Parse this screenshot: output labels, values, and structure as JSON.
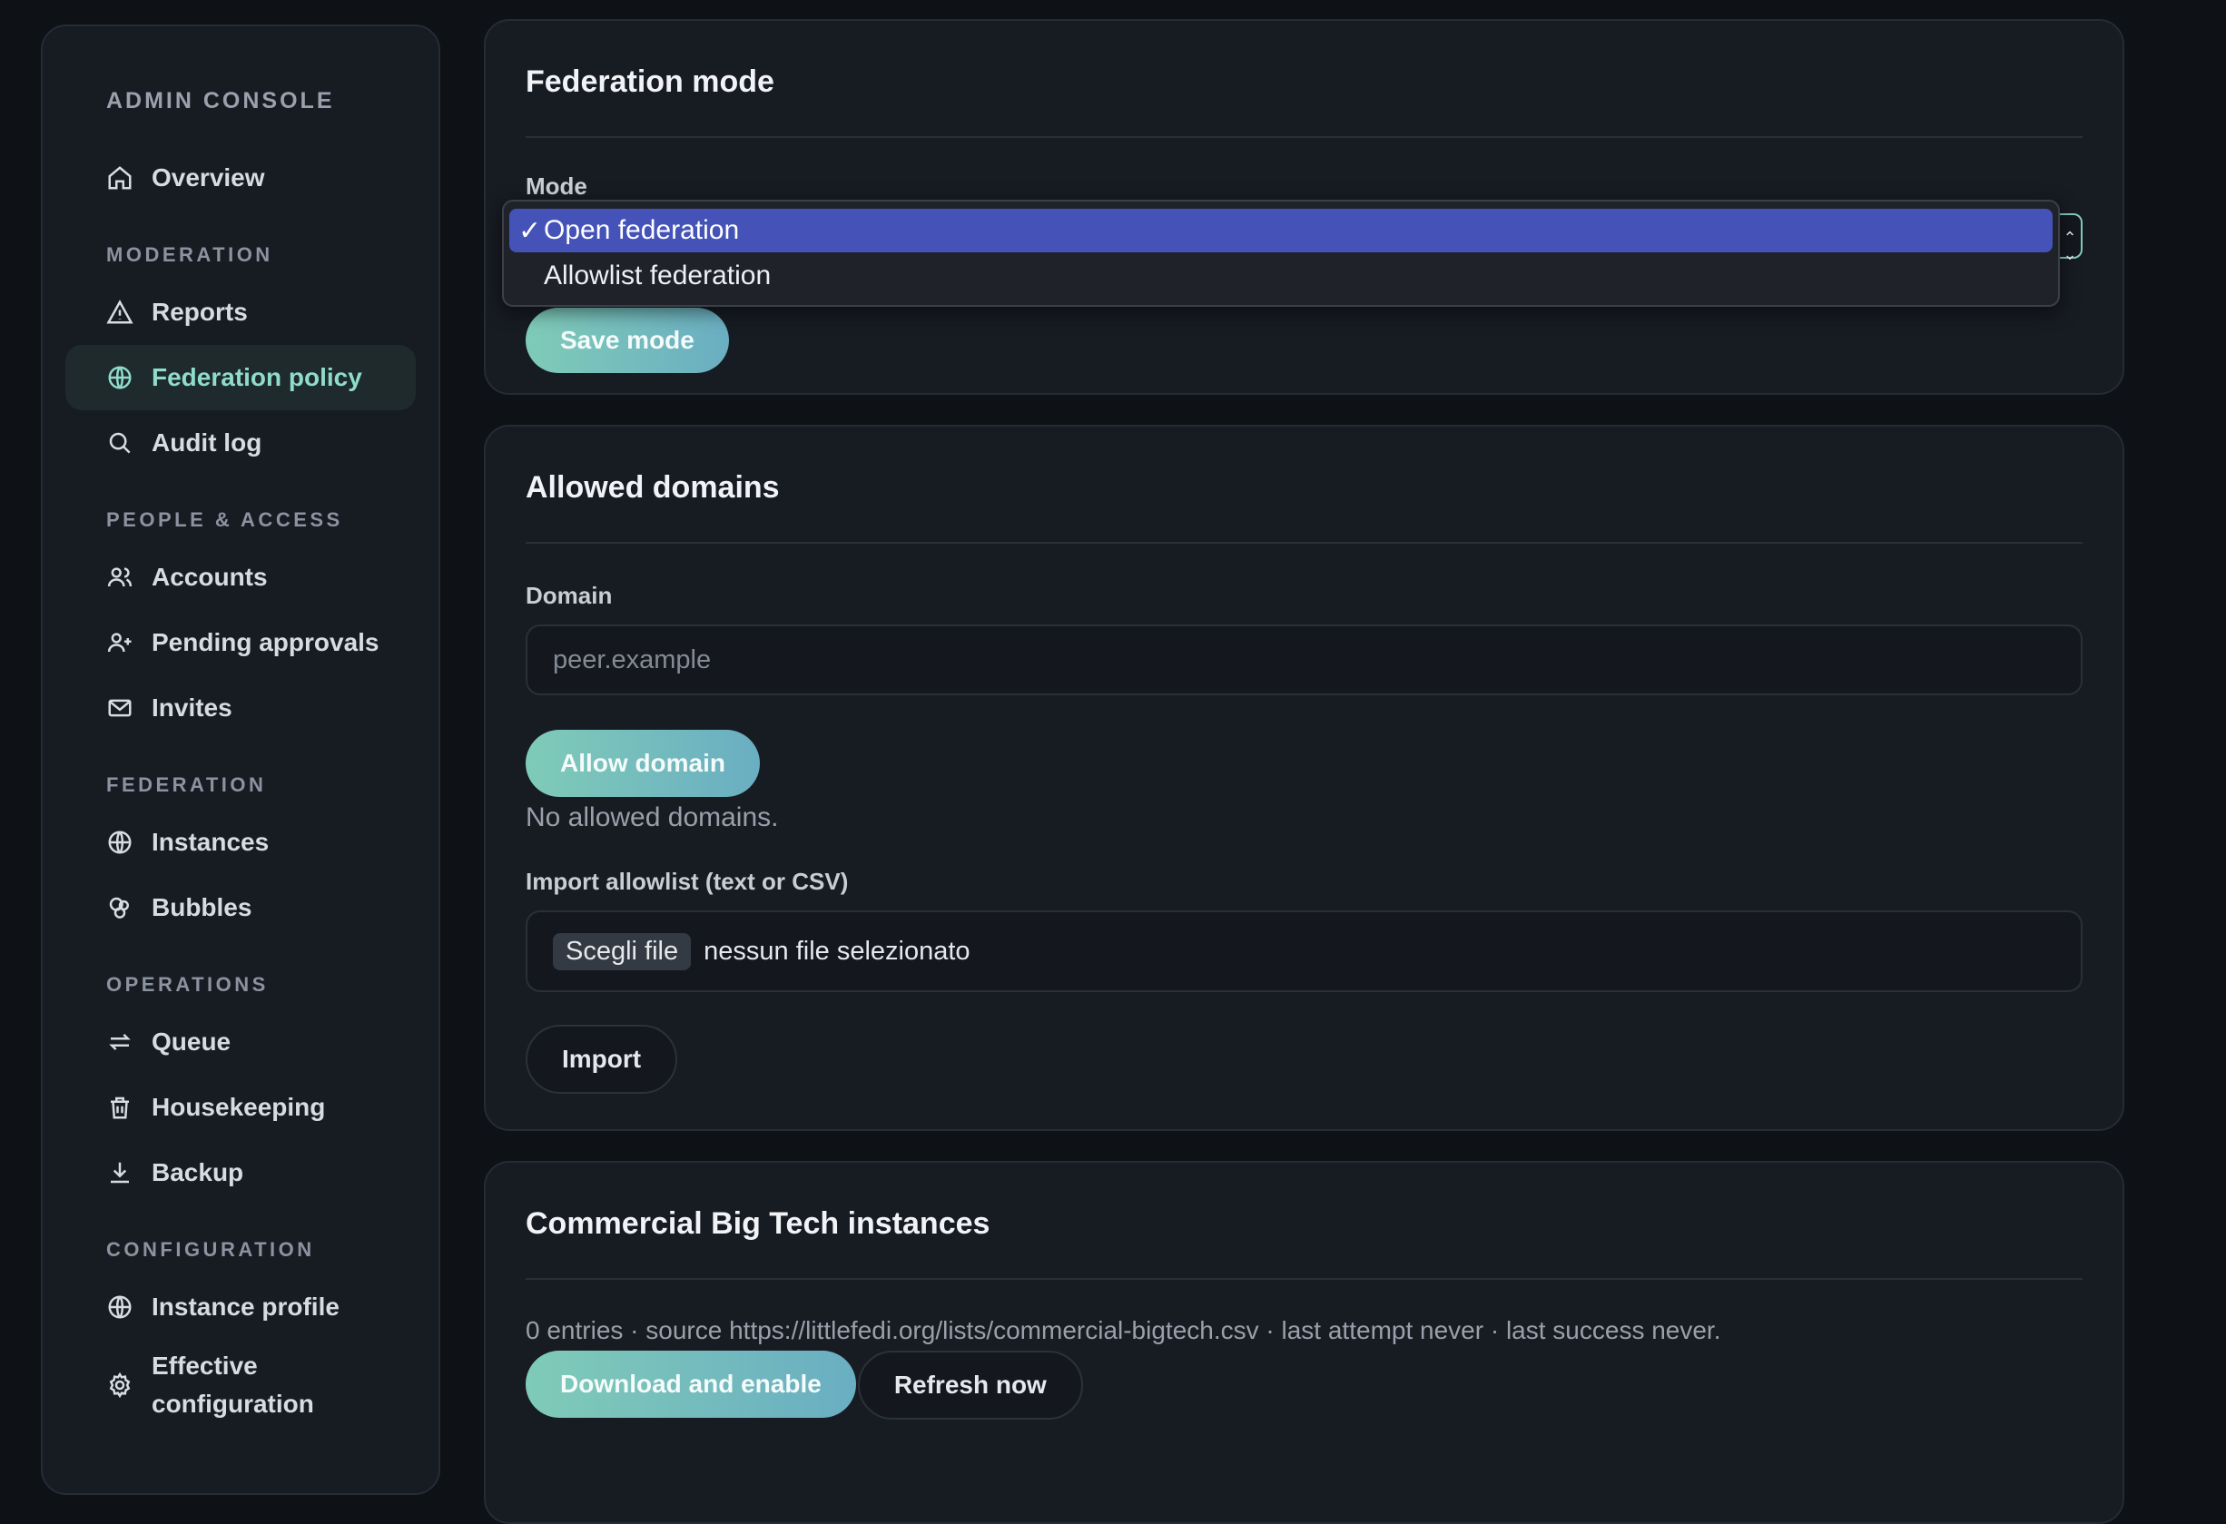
{
  "sidebar": {
    "brand": "ADMIN CONSOLE",
    "sections": {
      "top": [
        {
          "label": "Overview",
          "icon": "home-icon"
        }
      ],
      "moderation": {
        "title": "MODERATION",
        "items": [
          {
            "label": "Reports",
            "icon": "warning-icon"
          },
          {
            "label": "Federation policy",
            "icon": "globe-icon",
            "active": true
          },
          {
            "label": "Audit log",
            "icon": "search-icon"
          }
        ]
      },
      "people": {
        "title": "PEOPLE & ACCESS",
        "items": [
          {
            "label": "Accounts",
            "icon": "users-icon"
          },
          {
            "label": "Pending approvals",
            "icon": "user-plus-icon"
          },
          {
            "label": "Invites",
            "icon": "mail-icon"
          }
        ]
      },
      "federation": {
        "title": "FEDERATION",
        "items": [
          {
            "label": "Instances",
            "icon": "globe-icon"
          },
          {
            "label": "Bubbles",
            "icon": "bubbles-icon"
          }
        ]
      },
      "operations": {
        "title": "OPERATIONS",
        "items": [
          {
            "label": "Queue",
            "icon": "repeat-icon"
          },
          {
            "label": "Housekeeping",
            "icon": "trash-icon"
          },
          {
            "label": "Backup",
            "icon": "download-icon"
          }
        ]
      },
      "configuration": {
        "title": "CONFIGURATION",
        "items": [
          {
            "label": "Instance profile",
            "icon": "globe-icon"
          },
          {
            "label": "Effective configuration",
            "icon": "gear-icon"
          }
        ]
      }
    }
  },
  "mode_card": {
    "title": "Federation mode",
    "mode_label": "Mode",
    "selected": "Open federation",
    "options": [
      "Open federation",
      "Allowlist federation"
    ],
    "check": "✓",
    "save_label": "Save mode"
  },
  "allowed_card": {
    "title": "Allowed domains",
    "domain_label": "Domain",
    "domain_placeholder": "peer.example",
    "allow_label": "Allow domain",
    "empty_text": "No allowed domains.",
    "import_label": "Import allowlist (text or CSV)",
    "file_button": "Scegli file",
    "file_status": "nessun file selezionato",
    "import_button": "Import"
  },
  "bigtech_card": {
    "title": "Commercial Big Tech instances",
    "info": "0 entries · source https://littlefedi.org/lists/commercial-bigtech.csv · last attempt never · last success never.",
    "download_label": "Download and enable",
    "refresh_label": "Refresh now"
  },
  "colors": {
    "accent": "#7fcbb8",
    "selected_option": "#4553b8",
    "background": "#0e1116",
    "card": "#171b22"
  }
}
